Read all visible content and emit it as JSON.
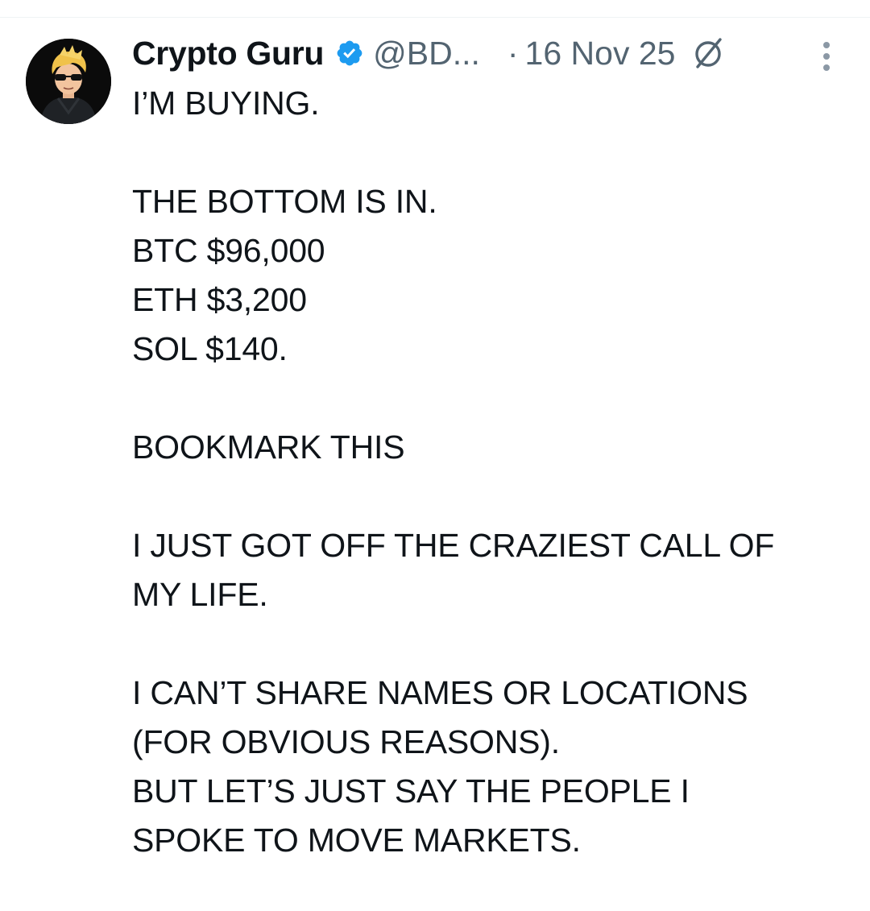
{
  "tweet": {
    "author": {
      "display_name": "Crypto Guru",
      "handle": "@BD...",
      "verified": true,
      "avatar_icon": "avatar-cartoon-sunglasses"
    },
    "separator": "·",
    "date": "16 Nov 25",
    "icons": {
      "verified": "verified-badge-icon",
      "grok": "grok-icon",
      "more": "more-options-icon"
    },
    "colors": {
      "text": "#0f1419",
      "secondary": "#536471",
      "verified_blue": "#1d9bf0"
    },
    "body": {
      "line_1": "I’M BUYING.",
      "line_2": "THE BOTTOM IS IN.",
      "line_3": "BTC $96,000",
      "line_4": "ETH $3,200",
      "line_5": "SOL $140.",
      "line_6": "BOOKMARK THIS",
      "line_7": "I JUST GOT OFF THE CRAZIEST CALL OF",
      "line_8": "MY LIFE.",
      "line_9": "I CAN’T SHARE NAMES OR LOCATIONS",
      "line_10": "(FOR OBVIOUS REASONS).",
      "line_11": "BUT LET’S JUST SAY THE PEOPLE I",
      "line_12": "SPOKE TO MOVE MARKETS."
    }
  }
}
